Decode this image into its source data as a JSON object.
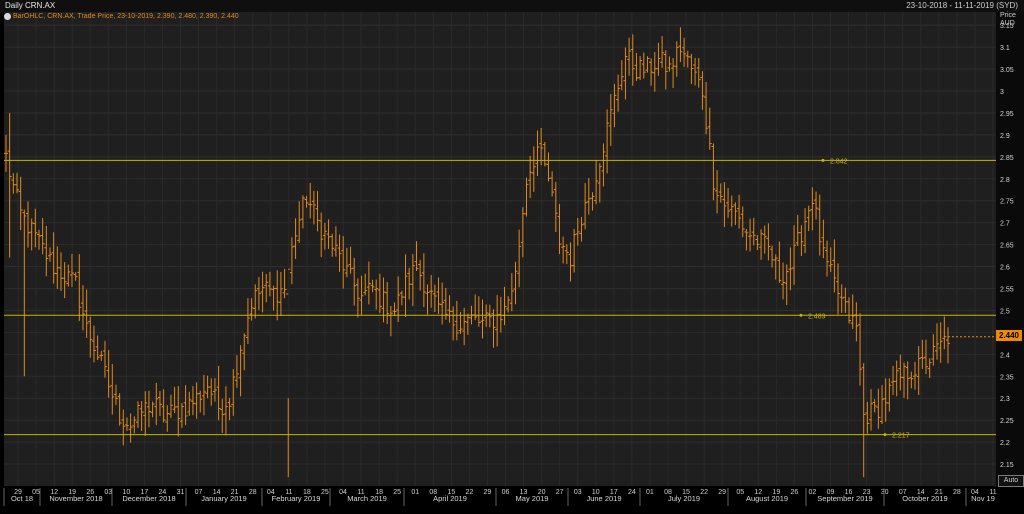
{
  "header": {
    "title": "Daily CRN.AX",
    "date_range": "23-10-2018 - 11-11-2019 (SYD)"
  },
  "legend": {
    "text": "BarOHLC, CRN.AX, Trade Price, 23-10-2019, 2.390, 2.480, 2.390, 2.440"
  },
  "y_axis": {
    "unit_label_1": "Price",
    "unit_label_2": "AUD",
    "last_price_label": "2.440"
  },
  "controls": {
    "auto_label": "Auto"
  },
  "colors": {
    "background": "#1f1f1f",
    "bars": "#e08a1a",
    "level_lines": "#c8b400",
    "badge": "#f08a00"
  },
  "chart_data": {
    "type": "bar",
    "subtype": "ohlc",
    "title": "Daily CRN.AX",
    "series_name": "CRN.AX",
    "ylim": [
      2.1,
      3.18
    ],
    "y_ticks": [
      2.15,
      2.2,
      2.25,
      2.3,
      2.35,
      2.4,
      2.45,
      2.5,
      2.55,
      2.6,
      2.65,
      2.7,
      2.75,
      2.8,
      2.85,
      2.9,
      2.95,
      3.0,
      3.05,
      3.1,
      3.15
    ],
    "y_tick_labels": [
      "2.15",
      "2.2",
      "2.25",
      "2.3",
      "2.35",
      "2.4",
      "2.45",
      "2.5",
      "2.55",
      "2.6",
      "2.65",
      "2.7",
      "2.75",
      "2.8",
      "2.85",
      "2.9",
      "2.95",
      "3",
      "3.05",
      "3.1",
      "3.15"
    ],
    "x_day_ticks": [
      "29",
      "05",
      "12",
      "19",
      "26",
      "03",
      "10",
      "17",
      "24",
      "31",
      "07",
      "14",
      "21",
      "28",
      "04",
      "11",
      "18",
      "25",
      "04",
      "11",
      "18",
      "25",
      "01",
      "08",
      "15",
      "22",
      "29",
      "06",
      "13",
      "20",
      "27",
      "03",
      "10",
      "17",
      "24",
      "01",
      "08",
      "15",
      "22",
      "29",
      "05",
      "12",
      "19",
      "26",
      "02",
      "09",
      "16",
      "23",
      "30",
      "07",
      "14",
      "21",
      "28",
      "04",
      "11"
    ],
    "x_month_labels": [
      "Oct 18",
      "November 2018",
      "December 2018",
      "January 2019",
      "February 2019",
      "March 2019",
      "April 2019",
      "May 2019",
      "June 2019",
      "July 2019",
      "August 2019",
      "September 2019",
      "October 2019",
      "Nov 19"
    ],
    "grid": true,
    "levels": [
      {
        "value": 2.842,
        "label": "2.842"
      },
      {
        "value": 2.489,
        "label": "2.489"
      },
      {
        "value": 2.217,
        "label": "2.217"
      }
    ],
    "last_price": 2.44,
    "anchors": [
      [
        0,
        2.85
      ],
      [
        2,
        2.78
      ],
      [
        4,
        2.72
      ],
      [
        7,
        2.68
      ],
      [
        10,
        2.64
      ],
      [
        13,
        2.6
      ],
      [
        16,
        2.58
      ],
      [
        19,
        2.56
      ],
      [
        22,
        2.46
      ],
      [
        25,
        2.4
      ],
      [
        28,
        2.33
      ],
      [
        31,
        2.26
      ],
      [
        34,
        2.24
      ],
      [
        37,
        2.27
      ],
      [
        40,
        2.29
      ],
      [
        43,
        2.26
      ],
      [
        46,
        2.27
      ],
      [
        49,
        2.28
      ],
      [
        52,
        2.3
      ],
      [
        55,
        2.33
      ],
      [
        58,
        2.28
      ],
      [
        61,
        2.3
      ],
      [
        64,
        2.42
      ],
      [
        67,
        2.52
      ],
      [
        70,
        2.55
      ],
      [
        73,
        2.54
      ],
      [
        76,
        2.55
      ],
      [
        79,
        2.68
      ],
      [
        82,
        2.76
      ],
      [
        85,
        2.7
      ],
      [
        88,
        2.66
      ],
      [
        91,
        2.62
      ],
      [
        94,
        2.57
      ],
      [
        97,
        2.53
      ],
      [
        100,
        2.55
      ],
      [
        103,
        2.52
      ],
      [
        106,
        2.5
      ],
      [
        109,
        2.56
      ],
      [
        112,
        2.6
      ],
      [
        115,
        2.55
      ],
      [
        118,
        2.5
      ],
      [
        121,
        2.48
      ],
      [
        124,
        2.47
      ],
      [
        127,
        2.48
      ],
      [
        130,
        2.47
      ],
      [
        133,
        2.48
      ],
      [
        136,
        2.5
      ],
      [
        139,
        2.58
      ],
      [
        142,
        2.8
      ],
      [
        145,
        2.87
      ],
      [
        148,
        2.8
      ],
      [
        151,
        2.66
      ],
      [
        154,
        2.62
      ],
      [
        157,
        2.72
      ],
      [
        160,
        2.78
      ],
      [
        163,
        2.88
      ],
      [
        166,
        2.98
      ],
      [
        169,
        3.08
      ],
      [
        172,
        3.05
      ],
      [
        175,
        3.05
      ],
      [
        178,
        3.07
      ],
      [
        181,
        3.05
      ],
      [
        184,
        3.1
      ],
      [
        187,
        3.05
      ],
      [
        190,
        3.0
      ],
      [
        193,
        2.8
      ],
      [
        196,
        2.74
      ],
      [
        199,
        2.72
      ],
      [
        202,
        2.68
      ],
      [
        205,
        2.66
      ],
      [
        208,
        2.64
      ],
      [
        211,
        2.58
      ],
      [
        214,
        2.6
      ],
      [
        217,
        2.68
      ],
      [
        220,
        2.76
      ],
      [
        223,
        2.62
      ],
      [
        226,
        2.56
      ],
      [
        229,
        2.5
      ],
      [
        232,
        2.46
      ],
      [
        234,
        2.26
      ],
      [
        237,
        2.27
      ],
      [
        240,
        2.3
      ],
      [
        243,
        2.34
      ],
      [
        246,
        2.36
      ],
      [
        249,
        2.37
      ],
      [
        252,
        2.39
      ],
      [
        255,
        2.42
      ],
      [
        257,
        2.44
      ]
    ]
  }
}
